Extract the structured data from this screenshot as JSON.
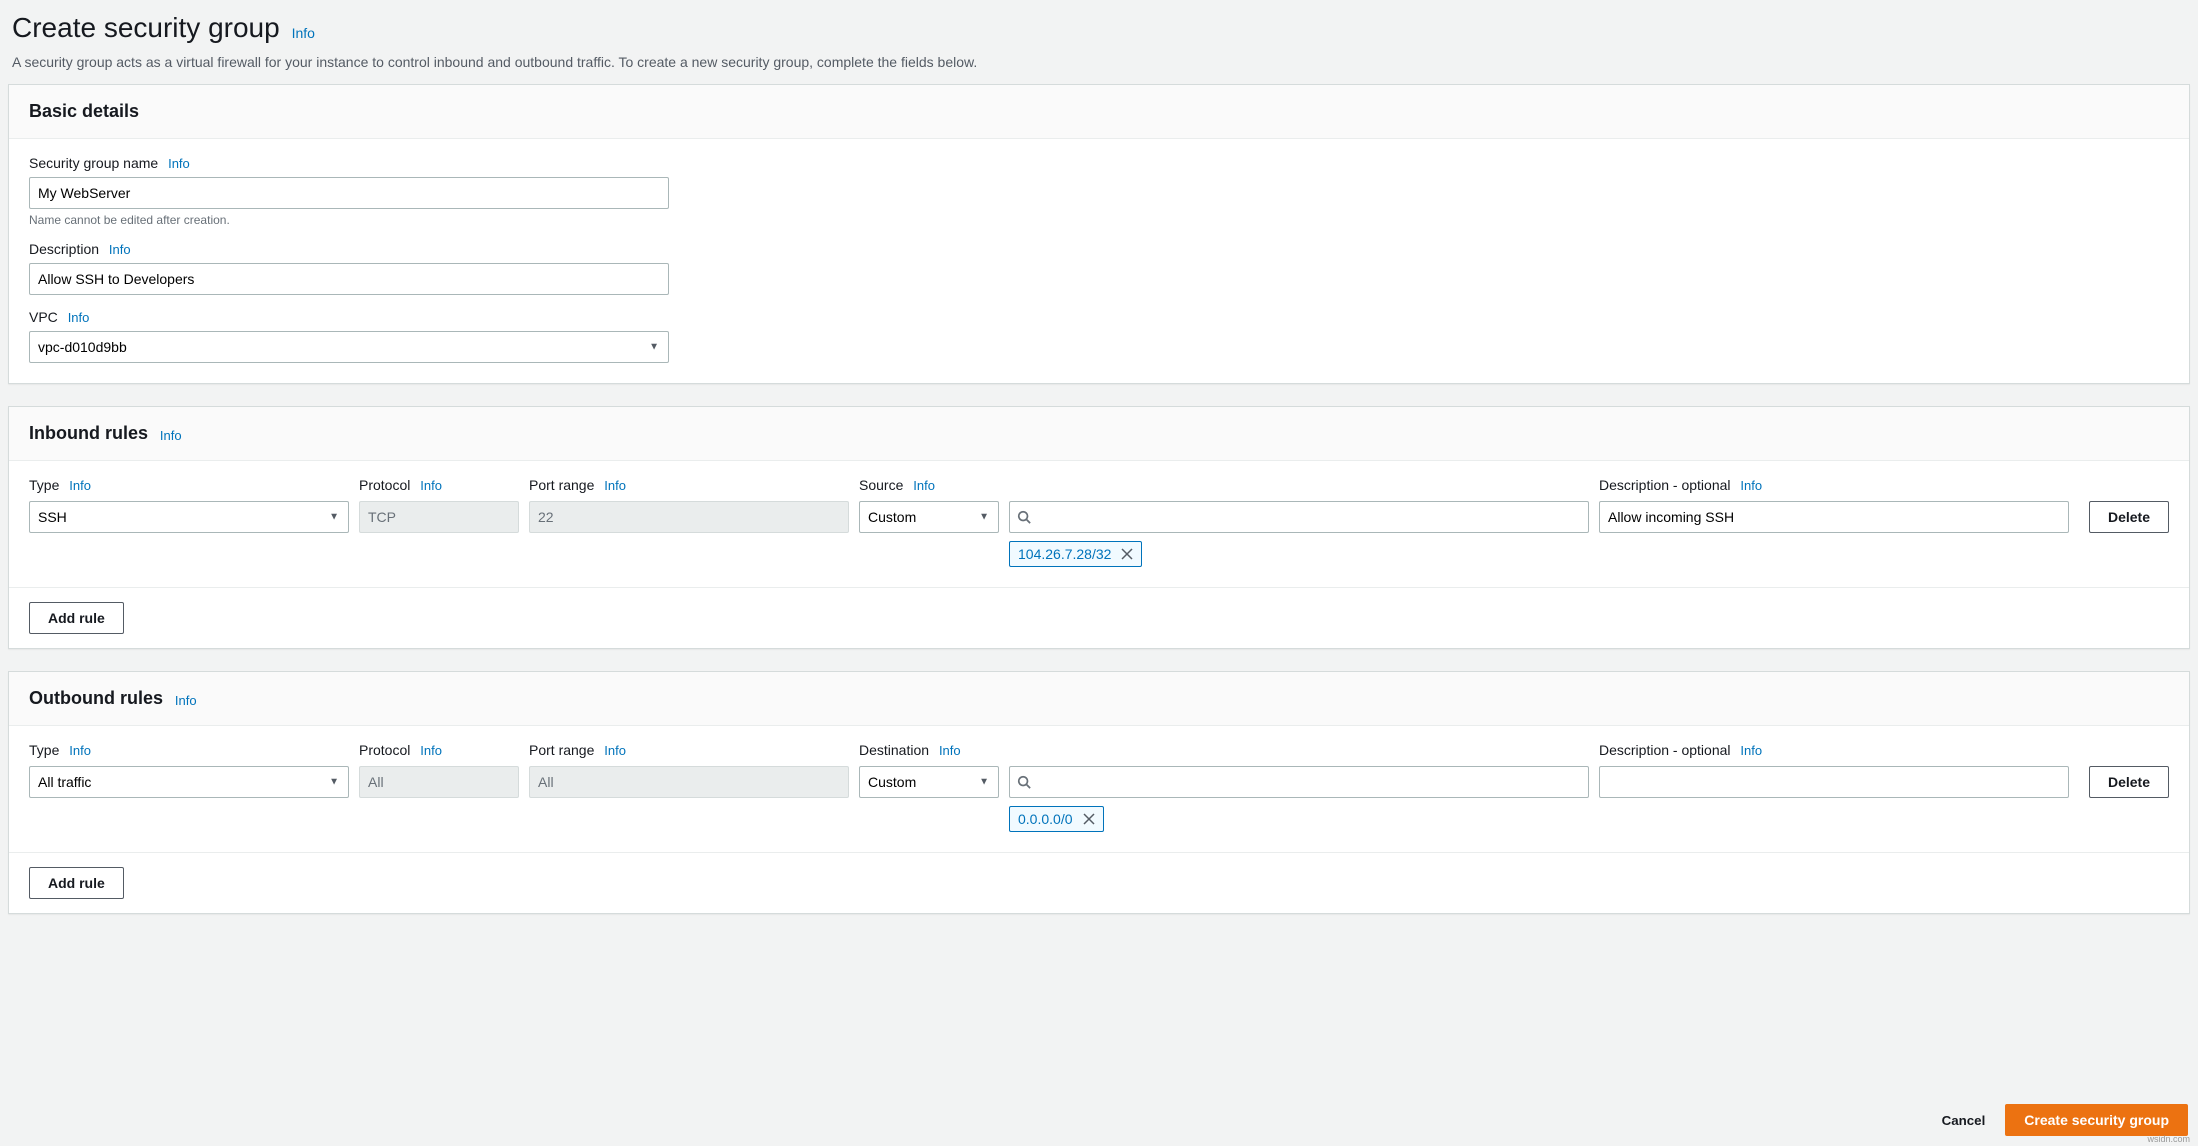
{
  "info_label": "Info",
  "header": {
    "title": "Create security group",
    "subtitle": "A security group acts as a virtual firewall for your instance to control inbound and outbound traffic. To create a new security group, complete the fields below."
  },
  "basic": {
    "title": "Basic details",
    "name_label": "Security group name",
    "name_value": "My WebServer",
    "name_hint": "Name cannot be edited after creation.",
    "desc_label": "Description",
    "desc_value": "Allow SSH to Developers",
    "vpc_label": "VPC",
    "vpc_value": "vpc-d010d9bb"
  },
  "inbound": {
    "title": "Inbound rules",
    "headers": {
      "type": "Type",
      "protocol": "Protocol",
      "port": "Port range",
      "source": "Source",
      "desc": "Description - optional"
    },
    "row": {
      "type": "SSH",
      "protocol": "TCP",
      "port": "22",
      "source_mode": "Custom",
      "source_tokens": [
        "104.26.7.28/32"
      ],
      "desc": "Allow incoming SSH"
    },
    "add_label": "Add rule",
    "delete_label": "Delete"
  },
  "outbound": {
    "title": "Outbound rules",
    "headers": {
      "type": "Type",
      "protocol": "Protocol",
      "port": "Port range",
      "dest": "Destination",
      "desc": "Description - optional"
    },
    "row": {
      "type": "All traffic",
      "protocol": "All",
      "port": "All",
      "dest_mode": "Custom",
      "dest_tokens": [
        "0.0.0.0/0"
      ],
      "desc": ""
    },
    "add_label": "Add rule",
    "delete_label": "Delete"
  },
  "footer": {
    "cancel": "Cancel",
    "submit": "Create security group"
  },
  "watermark": "wsidn.com"
}
